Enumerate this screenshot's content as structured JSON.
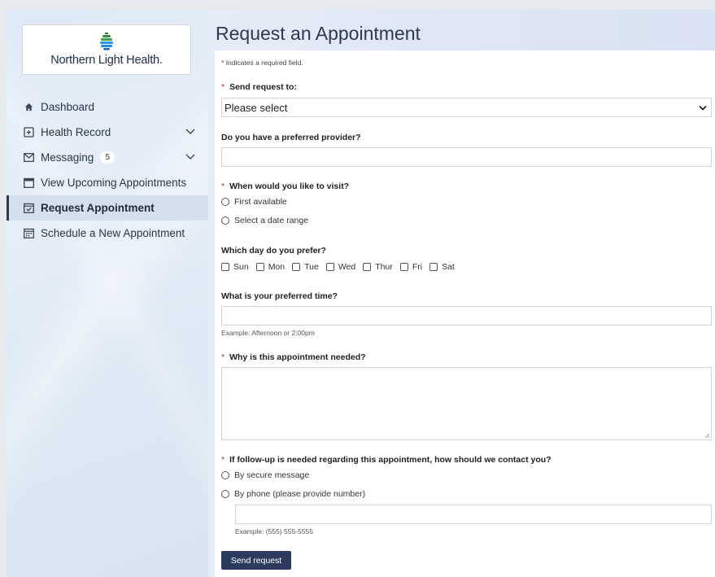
{
  "logo": {
    "text": "Northern Light Health."
  },
  "nav": {
    "items": [
      {
        "label": "Dashboard",
        "icon": "home-icon"
      },
      {
        "label": "Health Record",
        "icon": "health-record-icon"
      },
      {
        "label": "Messaging",
        "icon": "envelope-icon",
        "badge": "5"
      },
      {
        "label": "View Upcoming Appointments",
        "icon": "calendar-icon"
      },
      {
        "label": "Request Appointment",
        "icon": "calendar-check-icon"
      },
      {
        "label": "Schedule a New Appointment",
        "icon": "calendar-grid-icon"
      }
    ]
  },
  "page": {
    "title": "Request an Appointment"
  },
  "form": {
    "required_note": "Indicates a required field.",
    "send_to": {
      "label": "Send request to:",
      "value": "Please select"
    },
    "preferred_provider": {
      "label": "Do you have a preferred provider?",
      "value": ""
    },
    "visit_when": {
      "label": "When would you like to visit?",
      "options": [
        "First available",
        "Select a date range"
      ]
    },
    "preferred_day": {
      "label": "Which day do you prefer?",
      "days": [
        "Sun",
        "Mon",
        "Tue",
        "Wed",
        "Thur",
        "Fri",
        "Sat"
      ]
    },
    "preferred_time": {
      "label": "What is your preferred time?",
      "value": "",
      "hint": "Example: Afternoon or 2:00pm"
    },
    "reason": {
      "label": "Why is this appointment needed?",
      "value": ""
    },
    "follow_up": {
      "label": "If follow-up is needed regarding this appointment, how should we contact you?",
      "options": [
        "By secure message",
        "By phone (please provide number)"
      ],
      "phone_value": "",
      "phone_hint": "Example: (555) 555-5555"
    },
    "submit_label": "Send request"
  },
  "colors": {
    "accent": "#2c3a5e",
    "required": "#c0202f",
    "active_bar": "#2a3a55"
  }
}
